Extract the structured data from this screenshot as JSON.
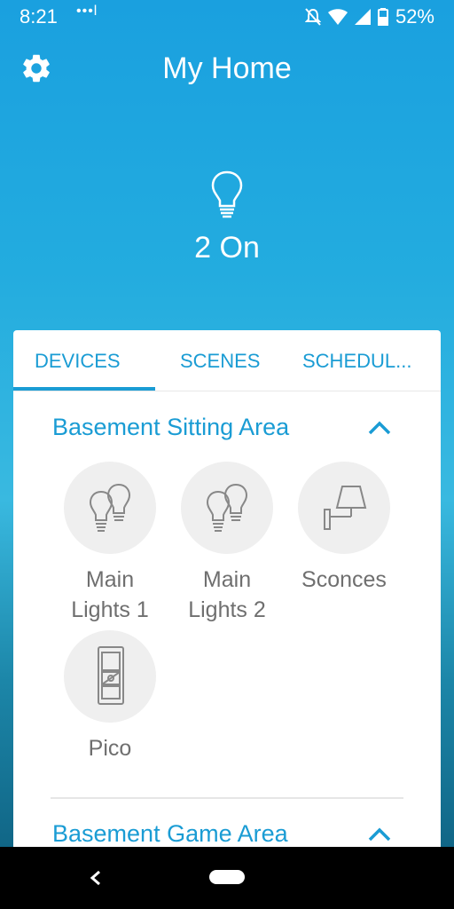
{
  "status_bar": {
    "time": "8:21",
    "dots": "•••l",
    "battery": "52%"
  },
  "header": {
    "title": "My Home"
  },
  "summary": {
    "on_text": "2 On"
  },
  "tabs": {
    "devices": "DEVICES",
    "scenes": "SCENES",
    "schedules": "SCHEDUL..."
  },
  "sections": [
    {
      "name": "Basement Sitting Area",
      "devices": [
        {
          "label_line1": "Main",
          "label_line2": "Lights 1",
          "icon": "double-bulb-icon"
        },
        {
          "label_line1": "Main",
          "label_line2": "Lights 2",
          "icon": "double-bulb-icon"
        },
        {
          "label_line1": "Sconces",
          "label_line2": "",
          "icon": "sconce-icon"
        },
        {
          "label_line1": "Pico",
          "label_line2": "",
          "icon": "pico-remote-icon"
        }
      ]
    },
    {
      "name": "Basement Game Area",
      "devices": []
    }
  ],
  "colors": {
    "accent": "#1a9cd4",
    "label": "#6f6f6f",
    "icon_circle": "#efefef"
  }
}
